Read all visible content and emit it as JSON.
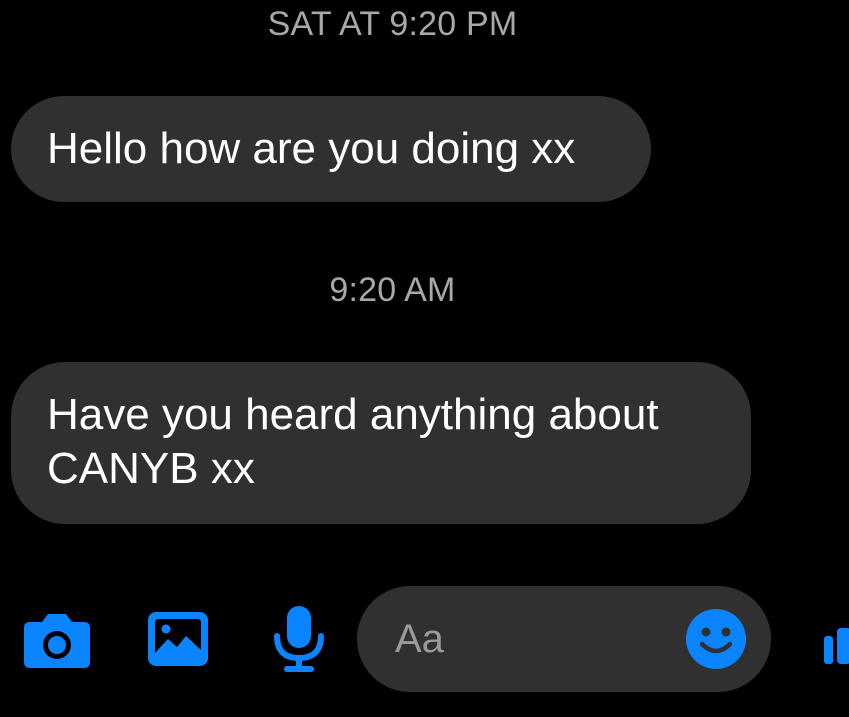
{
  "conversation": {
    "timestamps": [
      "SAT AT 9:20 PM",
      "9:20 AM"
    ],
    "messages": [
      {
        "text": "Hello how are you doing xx"
      },
      {
        "text": "Have you heard anything about CANYB xx"
      }
    ]
  },
  "composer": {
    "placeholder": "Aa",
    "icons": [
      "camera-icon",
      "image-icon",
      "microphone-icon",
      "emoji-icon",
      "thumbs-up-icon"
    ]
  },
  "colors": {
    "background": "#000000",
    "bubble": "#303030",
    "accent": "#0a84ff",
    "timestamp": "#a8a8a8",
    "placeholder": "#9a9a9a"
  }
}
